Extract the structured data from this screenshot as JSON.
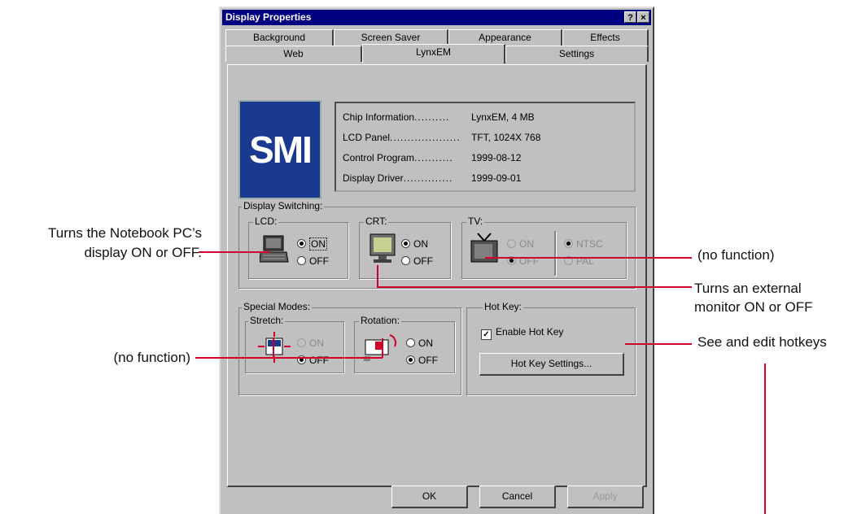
{
  "annotations": {
    "lcd_note_line1": "Turns the Notebook PC’s",
    "lcd_note_line2": "display ON or OFF.",
    "tv_note": "(no function)",
    "crt_note_line1": "Turns an external",
    "crt_note_line2": "monitor ON or OFF",
    "hotkey_note": "See and edit hotkeys",
    "special_note": "(no function)"
  },
  "window": {
    "title": "Display Properties",
    "help_glyph": "?",
    "close_glyph": "×"
  },
  "tabs": {
    "row1": [
      "Background",
      "Screen Saver",
      "Appearance",
      "Effects"
    ],
    "row2": [
      "Web",
      "LynxEM",
      "Settings"
    ],
    "active": "LynxEM"
  },
  "logo": {
    "text": "SMI",
    "color": "#1a3a8f"
  },
  "info": [
    {
      "label": "Chip Information",
      "dots": "..........",
      "value": "LynxEM, 4 MB"
    },
    {
      "label": "LCD Panel",
      "dots": "....................",
      "value": "TFT, 1024X 768"
    },
    {
      "label": "Control Program",
      "dots": "...........",
      "value": "1999-08-12"
    },
    {
      "label": "Display Driver",
      "dots": "..............",
      "value": "1999-09-01"
    }
  ],
  "display_switching": {
    "label": "Display Switching:",
    "lcd": {
      "label": "LCD:",
      "on": "ON",
      "off": "OFF",
      "selected": "ON"
    },
    "crt": {
      "label": "CRT:",
      "on": "ON",
      "off": "OFF",
      "selected": "ON"
    },
    "tv": {
      "label": "TV:",
      "on": "ON",
      "off": "OFF",
      "ntsc": "NTSC",
      "pal": "PAL"
    }
  },
  "special_modes": {
    "label": "Special Modes:",
    "stretch": {
      "label": "Stretch:",
      "on": "ON",
      "off": "OFF",
      "selected": "OFF"
    },
    "rotation": {
      "label": "Rotation:",
      "on": "ON",
      "off": "OFF",
      "selected": "OFF"
    }
  },
  "hotkey": {
    "label": "Hot Key:",
    "enable_label": "Enable Hot Key",
    "checked": true,
    "settings_button": "Hot Key Settings..."
  },
  "footer": {
    "ok": "OK",
    "cancel": "Cancel",
    "apply": "Apply"
  },
  "colors": {
    "callout_line": "#d0002a",
    "titlebar": "#000080",
    "face": "#c0c0c0"
  }
}
